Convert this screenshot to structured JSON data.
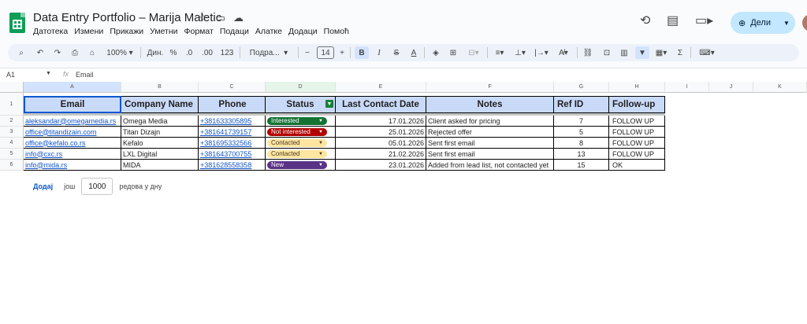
{
  "app": {
    "doc_title": "Data Entry Portfolio – Marija Maletic",
    "menu": [
      "Датотека",
      "Измени",
      "Прикажи",
      "Уметни",
      "Формат",
      "Подаци",
      "Алатке",
      "Додаци",
      "Помоћ"
    ],
    "share_label": "Дели"
  },
  "toolbar": {
    "zoom": "100%",
    "currency": "Дин.",
    "percent": "%",
    "dec_decrease": ".0",
    "dec_increase": ".00",
    "number_format": "123",
    "font": "Подра...",
    "font_size": "14",
    "bold": "B",
    "italic": "I",
    "strike": "S",
    "text_color": "A"
  },
  "formula_bar": {
    "cell_ref": "A1",
    "fx": "fx",
    "value": "Email"
  },
  "columns": [
    "A",
    "B",
    "C",
    "D",
    "E",
    "F",
    "G",
    "H",
    "I",
    "J",
    "K"
  ],
  "row_numbers": [
    "1",
    "2",
    "3",
    "4",
    "5",
    "6"
  ],
  "headers": [
    "Email",
    "Company Name",
    "Phone",
    "Status",
    "Last Contact Date",
    "Notes",
    "Ref ID",
    "Follow-up"
  ],
  "rows": [
    {
      "email": "aleksandar@omegamedia.rs",
      "company": "Omega Media",
      "phone": "+381633305895",
      "status": "Interested",
      "date": "17.01.2026",
      "notes": "Client asked for pricing",
      "ref": "7",
      "followup": "FOLLOW UP"
    },
    {
      "email": "office@titandizain.com",
      "company": "Titan Dizajn",
      "phone": "+381641739157",
      "status": "Not interested",
      "date": "25.01.2026",
      "notes": "Rejected offer",
      "ref": "5",
      "followup": "FOLLOW UP"
    },
    {
      "email": "office@kefalo.co.rs",
      "company": "Kefalo",
      "phone": "+381695332566",
      "status": "Contacted",
      "date": "05.01.2026",
      "notes": "Sent first email",
      "ref": "8",
      "followup": "FOLLOW UP"
    },
    {
      "email": "info@cxc.rs",
      "company": "LXL Digital",
      "phone": "+381643700755",
      "status": "Contacted",
      "date": "21.02.2026",
      "notes": "Sent first email",
      "ref": "13",
      "followup": "FOLLOW UP"
    },
    {
      "email": "info@mida.rs",
      "company": "MIDA",
      "phone": "+381628558358",
      "status": "New",
      "date": "23.01.2026",
      "notes": "Added from lead list, not contacted yet",
      "ref": "15",
      "followup": "OK"
    }
  ],
  "status_colors": {
    "Interested": {
      "bg": "#137333",
      "fg": "#ffffff"
    },
    "Not interested": {
      "bg": "#b10202",
      "fg": "#ffffff"
    },
    "Contacted": {
      "bg": "#ffe5a0",
      "fg": "#473821"
    },
    "New": {
      "bg": "#5a3286",
      "fg": "#ffffff"
    }
  },
  "add_rows": {
    "button": "Додај",
    "middle": "још",
    "count": "1000",
    "suffix": "редова у дну"
  }
}
